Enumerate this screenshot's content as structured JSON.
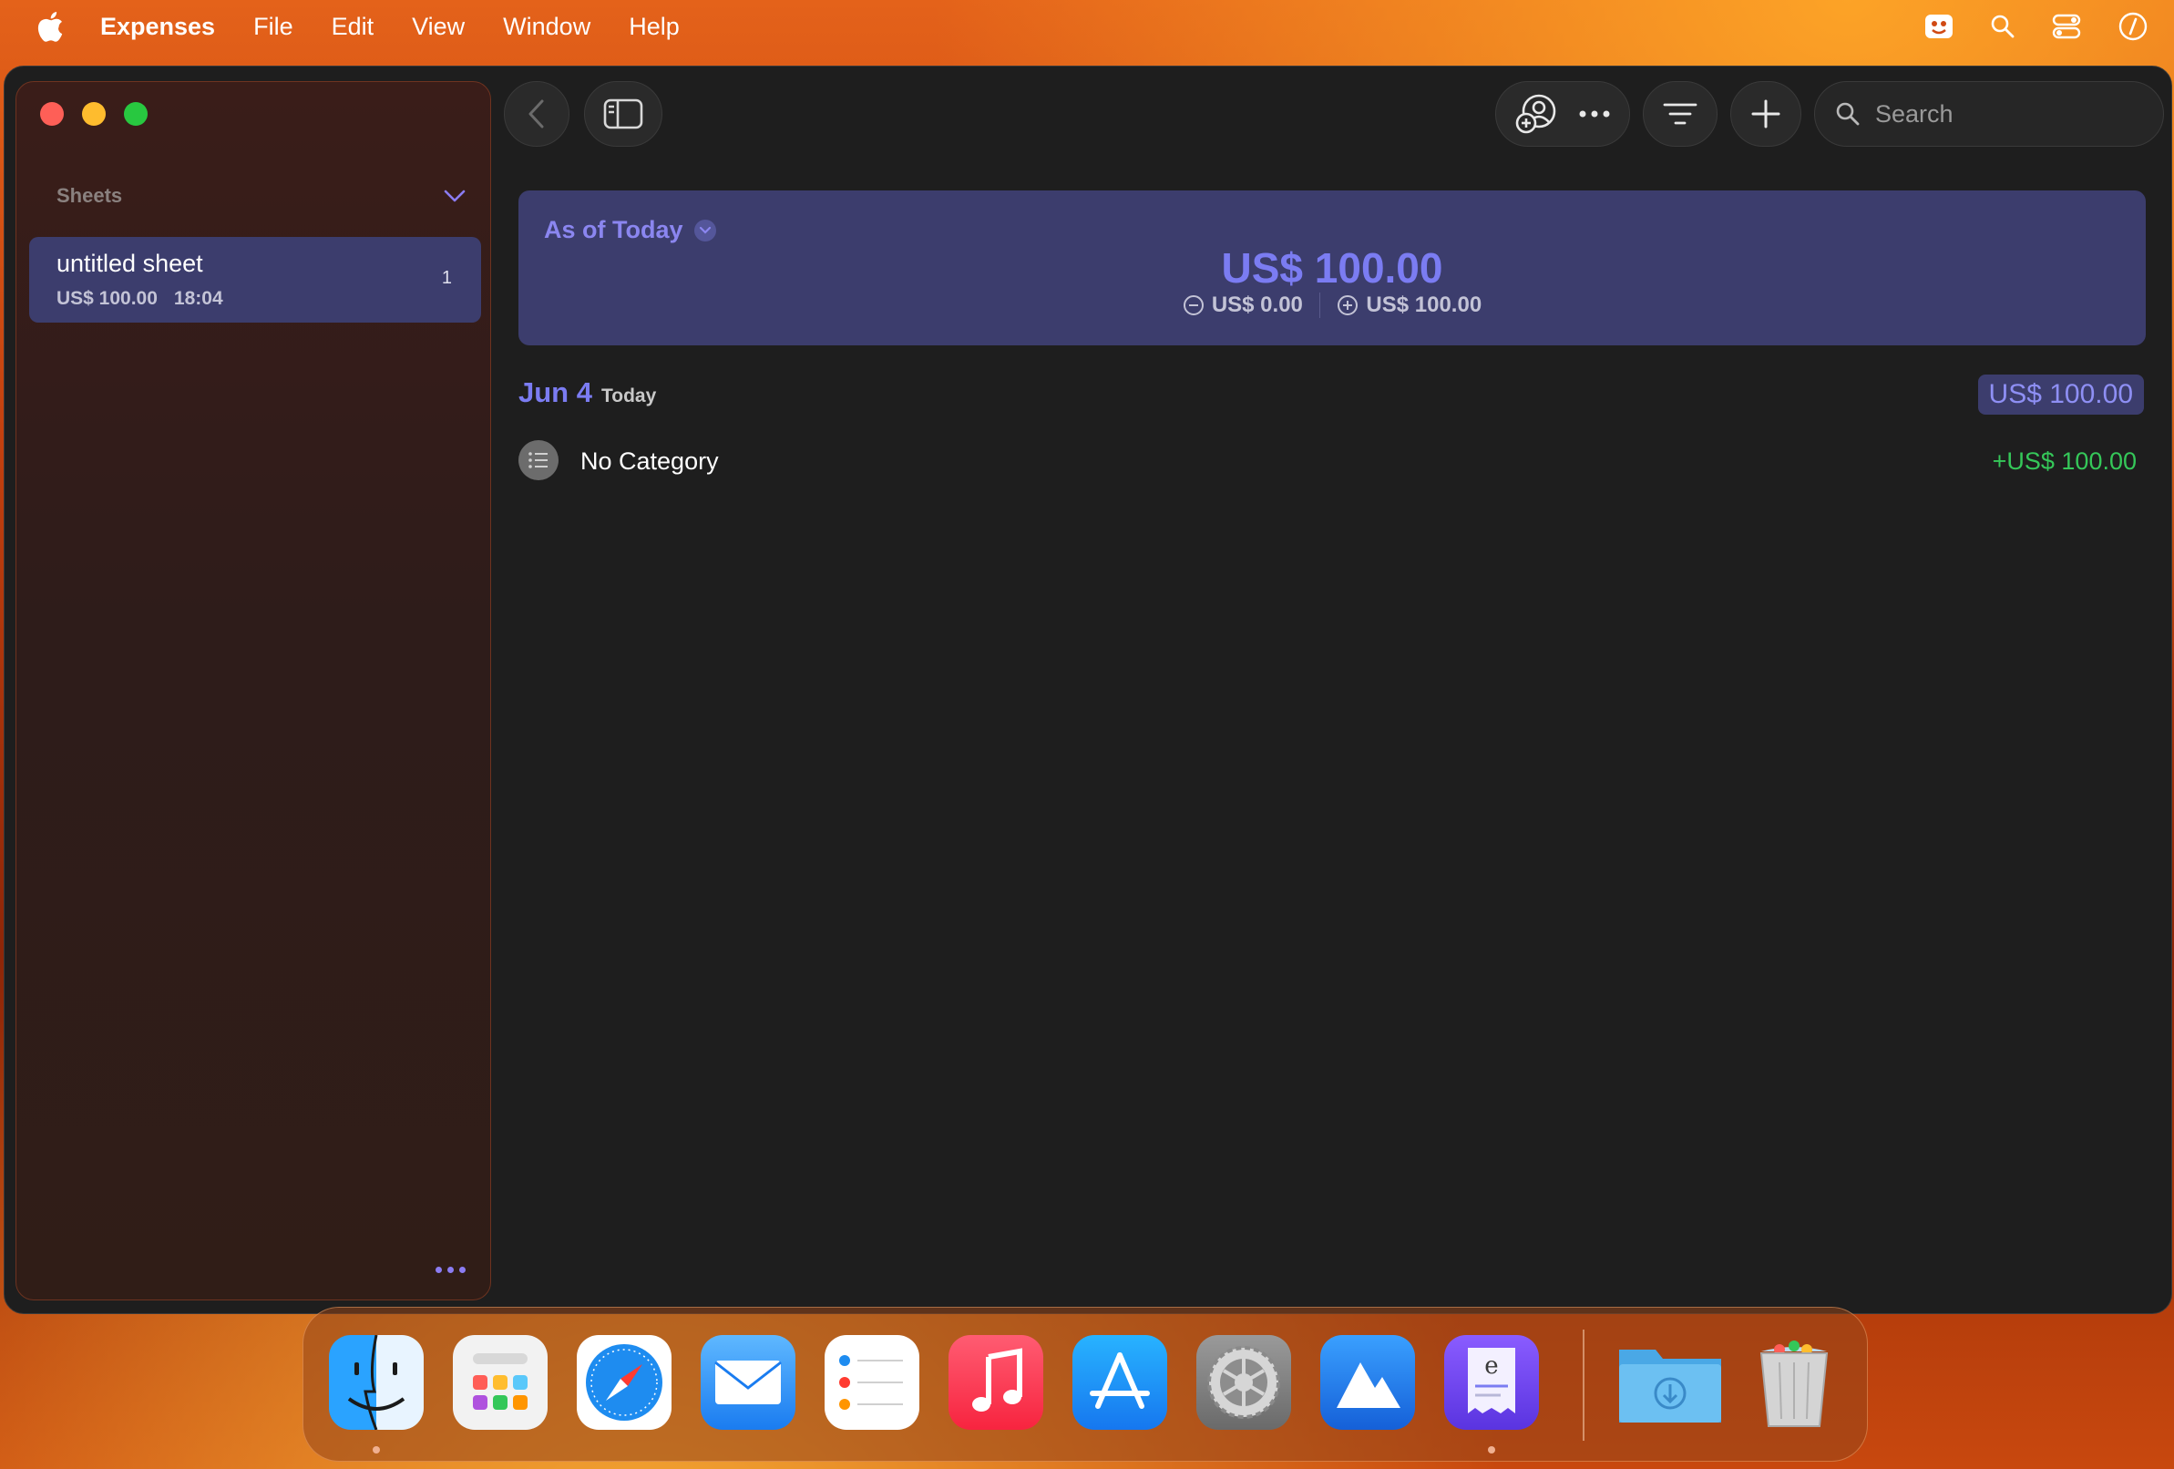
{
  "menubar": {
    "app_name": "Expenses",
    "items": [
      "File",
      "Edit",
      "View",
      "Window",
      "Help"
    ]
  },
  "sidebar": {
    "section_title": "Sheets",
    "sheets": [
      {
        "title": "untitled sheet",
        "amount": "US$ 100.00",
        "time": "18:04",
        "count": "1"
      }
    ]
  },
  "toolbar": {
    "search_placeholder": "Search"
  },
  "summary": {
    "period_label": "As of Today",
    "total": "US$ 100.00",
    "expenses": "US$ 0.00",
    "income": "US$ 100.00"
  },
  "day_group": {
    "date": "Jun 4",
    "relative": "Today",
    "total": "US$ 100.00",
    "entries": [
      {
        "category": "No Category",
        "amount": "+US$ 100.00"
      }
    ]
  },
  "dock": {
    "apps": [
      "finder-icon",
      "launchpad-icon",
      "safari-icon",
      "mail-icon",
      "reminders-icon",
      "music-icon",
      "app-store-icon",
      "system-settings-icon",
      "altitude-icon",
      "expenses-icon",
      "downloads-folder-icon",
      "trash-icon"
    ]
  },
  "colors": {
    "accent": "#7b7cf2",
    "income_green": "#35c759",
    "selection": "#3c3d6d"
  }
}
